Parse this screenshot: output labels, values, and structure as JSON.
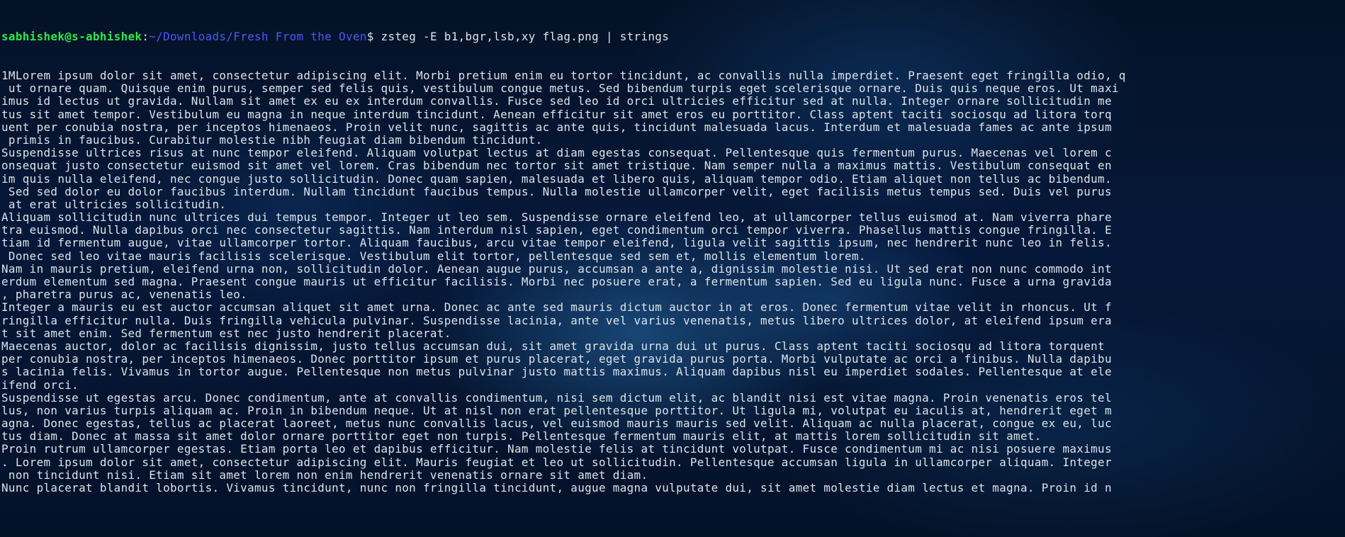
{
  "terminal": {
    "prompt": {
      "user_host": "sabhishek@s-abhishek",
      "separator": ":",
      "path": "~/Downloads/Fresh From the Oven",
      "symbol": "$ ",
      "command": "zsteg -E b1,bgr,lsb,xy flag.png | strings"
    },
    "output_lines": [
      "1MLorem ipsum dolor sit amet, consectetur adipiscing elit. Morbi pretium enim eu tortor tincidunt, ac convallis nulla imperdiet. Praesent eget fringilla odio, q",
      " ut ornare quam. Quisque enim purus, semper sed felis quis, vestibulum congue metus. Sed bibendum turpis eget scelerisque ornare. Duis quis neque eros. Ut maxi",
      "imus id lectus ut gravida. Nullam sit amet ex eu ex interdum convallis. Fusce sed leo id orci ultricies efficitur sed at nulla. Integer ornare sollicitudin me",
      "tus sit amet tempor. Vestibulum eu magna in neque interdum tincidunt. Aenean efficitur sit amet eros eu porttitor. Class aptent taciti sociosqu ad litora torq",
      "uent per conubia nostra, per inceptos himenaeos. Proin velit nunc, sagittis ac ante quis, tincidunt malesuada lacus. Interdum et malesuada fames ac ante ipsum",
      " primis in faucibus. Curabitur molestie nibh feugiat diam bibendum tincidunt.",
      "Suspendisse ultrices risus at nunc tempor eleifend. Aliquam volutpat lectus at diam egestas consequat. Pellentesque quis fermentum purus. Maecenas vel lorem c",
      "onsequat justo consectetur euismod sit amet vel lorem. Cras bibendum nec tortor sit amet tristique. Nam semper nulla a maximus mattis. Vestibulum consequat en",
      "im quis nulla eleifend, nec congue justo sollicitudin. Donec quam sapien, malesuada et libero quis, aliquam tempor odio. Etiam aliquet non tellus ac bibendum.",
      " Sed sed dolor eu dolor faucibus interdum. Nullam tincidunt faucibus tempus. Nulla molestie ullamcorper velit, eget facilisis metus tempus sed. Duis vel purus",
      " at erat ultricies sollicitudin.",
      "Aliquam sollicitudin nunc ultrices dui tempus tempor. Integer ut leo sem. Suspendisse ornare eleifend leo, at ullamcorper tellus euismod at. Nam viverra phare",
      "tra euismod. Nulla dapibus orci nec consectetur sagittis. Nam interdum nisl sapien, eget condimentum orci tempor viverra. Phasellus mattis congue fringilla. E",
      "tiam id fermentum augue, vitae ullamcorper tortor. Aliquam faucibus, arcu vitae tempor eleifend, ligula velit sagittis ipsum, nec hendrerit nunc leo in felis.",
      " Donec sed leo vitae mauris facilisis scelerisque. Vestibulum elit tortor, pellentesque sed sem et, mollis elementum lorem.",
      "Nam in mauris pretium, eleifend urna non, sollicitudin dolor. Aenean augue purus, accumsan a ante a, dignissim molestie nisi. Ut sed erat non nunc commodo int",
      "erdum elementum sed magna. Praesent congue mauris ut efficitur facilisis. Morbi nec posuere erat, a fermentum sapien. Sed eu ligula nunc. Fusce a urna gravida",
      ", pharetra purus ac, venenatis leo.",
      "Integer a mauris eu est auctor accumsan aliquet sit amet urna. Donec ac ante sed mauris dictum auctor in at eros. Donec fermentum vitae velit in rhoncus. Ut f",
      "ringilla efficitur nulla. Duis fringilla vehicula pulvinar. Suspendisse lacinia, ante vel varius venenatis, metus libero ultrices dolor, at eleifend ipsum era",
      "t sit amet enim. Sed fermentum est nec justo hendrerit placerat.",
      "Maecenas auctor, dolor ac facilisis dignissim, justo tellus accumsan dui, sit amet gravida urna dui ut purus. Class aptent taciti sociosqu ad litora torquent ",
      "per conubia nostra, per inceptos himenaeos. Donec porttitor ipsum et purus placerat, eget gravida purus porta. Morbi vulputate ac orci a finibus. Nulla dapibu",
      "s lacinia felis. Vivamus in tortor augue. Pellentesque non metus pulvinar justo mattis maximus. Aliquam dapibus nisl eu imperdiet sodales. Pellentesque at ele",
      "ifend orci.",
      "Suspendisse ut egestas arcu. Donec condimentum, ante at convallis condimentum, nisi sem dictum elit, ac blandit nisi est vitae magna. Proin venenatis eros tel",
      "lus, non varius turpis aliquam ac. Proin in bibendum neque. Ut at nisl non erat pellentesque porttitor. Ut ligula mi, volutpat eu iaculis at, hendrerit eget m",
      "agna. Donec egestas, tellus ac placerat laoreet, metus nunc convallis lacus, vel euismod mauris mauris sed velit. Aliquam ac nulla placerat, congue ex eu, luc",
      "tus diam. Donec at massa sit amet dolor ornare porttitor eget non turpis. Pellentesque fermentum mauris elit, at mattis lorem sollicitudin sit amet.",
      "Proin rutrum ullamcorper egestas. Etiam porta leo et dapibus efficitur. Nam molestie felis at tincidunt volutpat. Fusce condimentum mi ac nisi posuere maximus",
      ". Lorem ipsum dolor sit amet, consectetur adipiscing elit. Mauris feugiat et leo ut sollicitudin. Pellentesque accumsan ligula in ullamcorper aliquam. Integer",
      " non tincidunt nisi. Etiam sit amet lorem non enim hendrerit venenatis ornare sit amet diam.",
      "Nunc placerat blandit lobortis. Vivamus tincidunt, nunc non fringilla tincidunt, augue magna vulputate dui, sit amet molestie diam lectus et magna. Proin id n"
    ]
  },
  "colors": {
    "user_host": "#2ee84c",
    "path": "#4a59ff",
    "text": "#dde3ea",
    "background": "#041226"
  }
}
